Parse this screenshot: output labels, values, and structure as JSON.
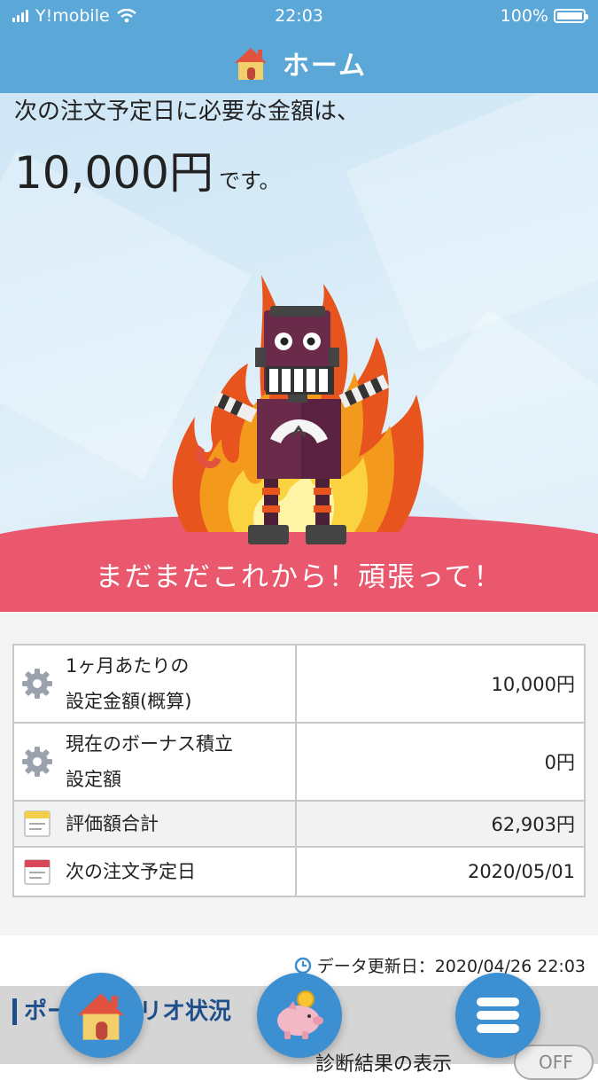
{
  "status_bar": {
    "carrier": "Y!mobile",
    "time": "22:03",
    "battery": "100%"
  },
  "header": {
    "title": "ホーム",
    "icon": "house-icon"
  },
  "hero": {
    "line1": "次の注文予定日に必要な金額は、",
    "amount": "10,000円",
    "suffix": "です。",
    "message": "まだまだこれから！頑張って！"
  },
  "info_rows": [
    {
      "icon": "gear-icon",
      "label": [
        "1ヶ月あたりの",
        "設定金額(概算)"
      ],
      "value": "10,000円"
    },
    {
      "icon": "gear-icon",
      "label": [
        "現在のボーナス積立",
        "設定額"
      ],
      "value": "0円"
    },
    {
      "icon": "notepad-icon",
      "label": [
        "評価額合計"
      ],
      "value": "62,903円"
    },
    {
      "icon": "calendar-icon",
      "label": [
        "次の注文予定日"
      ],
      "value": "2020/05/01"
    }
  ],
  "updated": {
    "label": "データ更新日：2020/04/26 22:03"
  },
  "portfolio": {
    "title": "ポートフォリオ状況",
    "diagnosis_label": "診断結果の表示",
    "toggle": "OFF"
  },
  "nav": {
    "home": "house-icon",
    "savings": "piggy-bank-icon",
    "menu": "menu-icon"
  },
  "colors": {
    "header": "#5aa7d8",
    "ground": "#e9586d",
    "fab": "#3c8fd0"
  }
}
